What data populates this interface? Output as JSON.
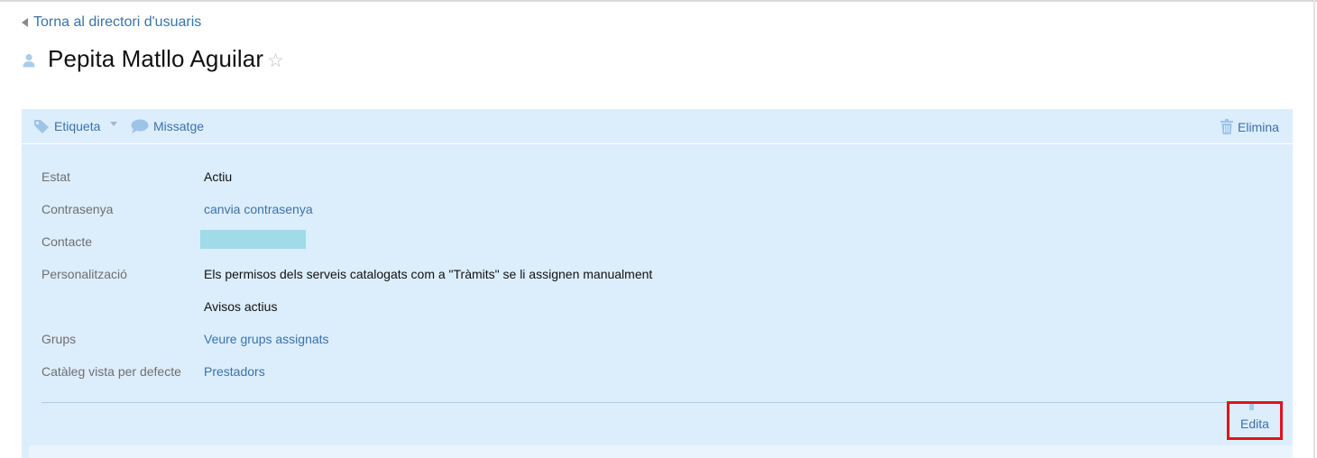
{
  "nav": {
    "back_label": "Torna al directori d'usuaris"
  },
  "header": {
    "title": "Pepita Matllo Aguilar"
  },
  "toolbar": {
    "tag_label": "Etiqueta",
    "message_label": "Missatge",
    "delete_label": "Elimina"
  },
  "fields": [
    {
      "label": "Estat",
      "value": "Actiu"
    },
    {
      "label": "Contrasenya",
      "value": "canvia contrasenya"
    },
    {
      "label": "Contacte",
      "value": ""
    },
    {
      "label": "Personalització",
      "value": "Els permisos dels serveis catalogats com a \"Tràmits\" se li assignen manualment"
    },
    {
      "label": "",
      "value": "Avisos actius"
    },
    {
      "label": "Grups",
      "value": "Veure grups assignats"
    },
    {
      "label": "Catàleg vista per defecte",
      "value": "Prestadors"
    }
  ],
  "actions": {
    "edit_label": "Edita"
  },
  "colors": {
    "link": "#3b73a8",
    "panel_bg": "#dcedfc",
    "highlight_border": "#e0131c"
  }
}
